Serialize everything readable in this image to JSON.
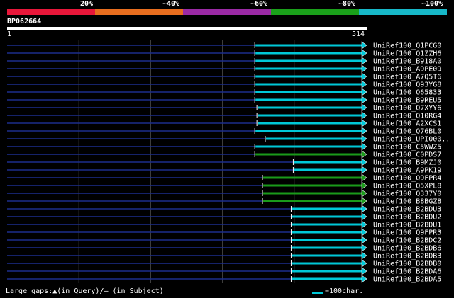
{
  "header": {
    "pct_labels": [
      "20%",
      "~40%",
      "~60%",
      "~80%",
      "~100%"
    ],
    "band_colors": [
      "#e8173a",
      "#e86e1f",
      "#9b2aa5",
      "#1aa01a",
      "#17b8c8"
    ]
  },
  "query": {
    "name": "BP062664",
    "start": "1",
    "end": "514",
    "length": 514
  },
  "colors": {
    "gap": "#1c2e8c",
    "cyan": "#00c8d8",
    "green": "#1a9a1a",
    "grid": "#444"
  },
  "hits": [
    {
      "name": "UniRef100_Q1PCG0",
      "start": 355,
      "end": 514,
      "color": "cyan"
    },
    {
      "name": "UniRef100_Q1ZZH6",
      "start": 355,
      "end": 514,
      "color": "cyan"
    },
    {
      "name": "UniRef100_B918A0",
      "start": 355,
      "end": 514,
      "color": "cyan"
    },
    {
      "name": "UniRef100_A9PE09",
      "start": 355,
      "end": 514,
      "color": "cyan"
    },
    {
      "name": "UniRef100_A7Q5T6",
      "start": 355,
      "end": 514,
      "color": "cyan"
    },
    {
      "name": "UniRef100_Q93YG8",
      "start": 355,
      "end": 514,
      "color": "cyan"
    },
    {
      "name": "UniRef100_O65833",
      "start": 355,
      "end": 514,
      "color": "cyan"
    },
    {
      "name": "UniRef100_B9REU5",
      "start": 355,
      "end": 514,
      "color": "cyan"
    },
    {
      "name": "UniRef100_Q7XYY6",
      "start": 358,
      "end": 514,
      "color": "cyan"
    },
    {
      "name": "UniRef100_Q10RG4",
      "start": 358,
      "end": 514,
      "color": "cyan"
    },
    {
      "name": "UniRef100_A2XCS1",
      "start": 358,
      "end": 514,
      "color": "cyan"
    },
    {
      "name": "UniRef100_Q76BL0",
      "start": 355,
      "end": 514,
      "color": "cyan"
    },
    {
      "name": "UniRef100_UPI000..",
      "start": 370,
      "end": 514,
      "color": "cyan"
    },
    {
      "name": "UniRef100_C5WWZ5",
      "start": 355,
      "end": 514,
      "color": "cyan"
    },
    {
      "name": "UniRef100_C0PDS7",
      "start": 355,
      "end": 514,
      "color": "green"
    },
    {
      "name": "UniRef100_B9MZJ0",
      "start": 410,
      "end": 514,
      "color": "cyan"
    },
    {
      "name": "UniRef100_A9PK19",
      "start": 410,
      "end": 514,
      "color": "cyan"
    },
    {
      "name": "UniRef100_Q9FPR4",
      "start": 366,
      "end": 514,
      "color": "green"
    },
    {
      "name": "UniRef100_Q5XPL8",
      "start": 366,
      "end": 514,
      "color": "green"
    },
    {
      "name": "UniRef100_Q337Y0",
      "start": 366,
      "end": 514,
      "color": "green"
    },
    {
      "name": "UniRef100_B8BGZ8",
      "start": 366,
      "end": 514,
      "color": "green"
    },
    {
      "name": "UniRef100_B2BDU3",
      "start": 407,
      "end": 514,
      "color": "cyan"
    },
    {
      "name": "UniRef100_B2BDU2",
      "start": 407,
      "end": 514,
      "color": "cyan"
    },
    {
      "name": "UniRef100_B2BDU1",
      "start": 407,
      "end": 514,
      "color": "cyan"
    },
    {
      "name": "UniRef100_Q9FPR3",
      "start": 407,
      "end": 514,
      "color": "cyan"
    },
    {
      "name": "UniRef100_B2BDC2",
      "start": 407,
      "end": 514,
      "color": "cyan"
    },
    {
      "name": "UniRef100_B2BDB6",
      "start": 407,
      "end": 514,
      "color": "cyan"
    },
    {
      "name": "UniRef100_B2BDB3",
      "start": 407,
      "end": 514,
      "color": "cyan"
    },
    {
      "name": "UniRef100_B2BDB0",
      "start": 407,
      "end": 514,
      "color": "cyan"
    },
    {
      "name": "UniRef100_B2BDA6",
      "start": 407,
      "end": 514,
      "color": "cyan"
    },
    {
      "name": "UniRef100_B2BDA5",
      "start": 407,
      "end": 514,
      "color": "cyan"
    }
  ],
  "legend": {
    "gaps_text": "Large gaps:▲(in Query)/— (in Subject)",
    "scale_text": "=100char."
  }
}
